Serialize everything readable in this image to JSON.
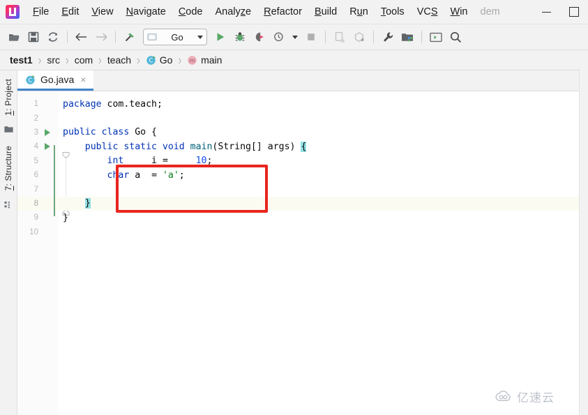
{
  "window": {
    "app_logo": "intellij-idea-logo",
    "truncated_title": "dem",
    "minimize_label": "Minimize",
    "maximize_label": "Maximize"
  },
  "menubar": {
    "items": [
      {
        "label": "File",
        "mnemonic": "F"
      },
      {
        "label": "Edit",
        "mnemonic": "E"
      },
      {
        "label": "View",
        "mnemonic": "V"
      },
      {
        "label": "Navigate",
        "mnemonic": "N"
      },
      {
        "label": "Code",
        "mnemonic": "C"
      },
      {
        "label": "Analyze",
        "mnemonic": "z"
      },
      {
        "label": "Refactor",
        "mnemonic": "R"
      },
      {
        "label": "Build",
        "mnemonic": "B"
      },
      {
        "label": "Run",
        "mnemonic": "u"
      },
      {
        "label": "Tools",
        "mnemonic": "T"
      },
      {
        "label": "VCS",
        "mnemonic": "S"
      },
      {
        "label": "Win",
        "mnemonic": "W"
      }
    ]
  },
  "toolbar": {
    "open_label": "Open",
    "save_label": "Save All",
    "sync_label": "Synchronize",
    "back_label": "Back",
    "forward_label": "Forward",
    "build_label": "Build Project",
    "run_config": "Go",
    "run_label": "Run",
    "debug_label": "Debug",
    "run_coverage_label": "Run with Coverage",
    "profile_label": "Profile",
    "stop_label": "Stop",
    "update_app_label": "Update Application",
    "install_label": "Install",
    "settings_label": "Settings",
    "project_structure_label": "Project Structure",
    "terminal_label": "Terminal",
    "search_label": "Search Everywhere"
  },
  "breadcrumb": {
    "items": [
      {
        "label": "test1",
        "icon": "",
        "bold": true
      },
      {
        "label": "src",
        "icon": "",
        "bold": false
      },
      {
        "label": "com",
        "icon": "",
        "bold": false
      },
      {
        "label": "teach",
        "icon": "",
        "bold": false
      },
      {
        "label": "Go",
        "icon": "class-icon",
        "bold": false
      },
      {
        "label": "main",
        "icon": "method-icon",
        "bold": false
      }
    ],
    "separator": "›"
  },
  "toolstrip": {
    "project_tab": "1: Project",
    "project_mnemonic": "1",
    "structure_tab": "7: Structure",
    "structure_mnemonic": "7",
    "project_icon": "folder-icon",
    "structure_icon": "structure-icon"
  },
  "editor_tabs": {
    "active": {
      "label": "Go.java",
      "icon": "java-class-icon",
      "close": "×"
    }
  },
  "code": {
    "language": "java",
    "current_line": 8,
    "lines": [
      {
        "n": 1,
        "run_marker": false,
        "text": "package com.teach;"
      },
      {
        "n": 2,
        "run_marker": false,
        "text": ""
      },
      {
        "n": 3,
        "run_marker": true,
        "text": "public class Go {"
      },
      {
        "n": 4,
        "run_marker": true,
        "text": "    public static void main(String[] args) {"
      },
      {
        "n": 5,
        "run_marker": false,
        "text": "        int     i =     10;"
      },
      {
        "n": 6,
        "run_marker": false,
        "text": "        char a  = 'a';"
      },
      {
        "n": 7,
        "run_marker": false,
        "text": ""
      },
      {
        "n": 8,
        "run_marker": false,
        "text": "    }"
      },
      {
        "n": 9,
        "run_marker": false,
        "text": "}"
      },
      {
        "n": 10,
        "run_marker": false,
        "text": ""
      }
    ],
    "tokens": {
      "kw_package": "package",
      "pkg_name": " com.teach;",
      "kw_public": "public",
      "kw_class": "class",
      "class_name": "Go",
      "brace_open": "{",
      "kw_static": "static",
      "kw_void": "void",
      "method_name": "main",
      "params": "(String[] args)",
      "kw_int": "int",
      "var_i": "i",
      "eq": "=",
      "num_10": "10",
      "semi": ";",
      "kw_char": "char",
      "var_a": "a",
      "char_lit": "'a'",
      "brace_close": "}"
    }
  },
  "annotation": {
    "type": "red-rectangle",
    "color": "#e8251f",
    "covers_lines": "5-7"
  },
  "watermark": {
    "text": "亿速云",
    "icon": "cloud-icon"
  },
  "colors": {
    "accent_tab": "#4083c9",
    "keyword": "#0033b3",
    "number": "#1750eb",
    "string": "#067d17",
    "method": "#00627a",
    "run_green": "#59a869",
    "brace_match": "#93e0e3",
    "current_line": "#fcfbf2",
    "annotation_red": "#e8251f",
    "chrome_bg": "#f2f2f2"
  }
}
